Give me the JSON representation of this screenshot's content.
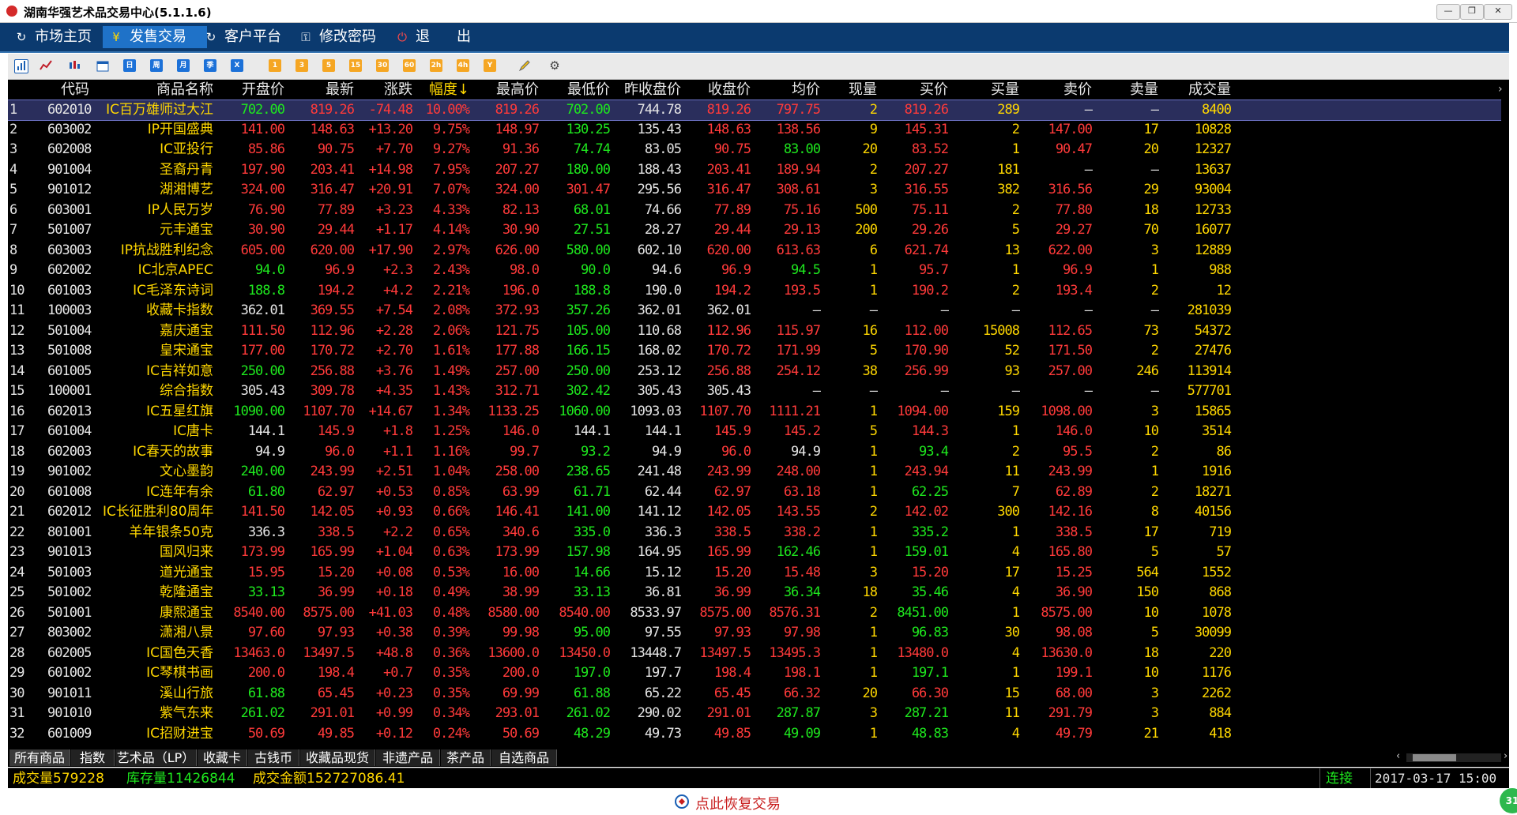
{
  "window": {
    "title": "湖南华强艺术品交易中心(5.1.1.6)"
  },
  "menu": [
    {
      "label": "市场主页",
      "icon": "refresh-icon",
      "glyph": "↻"
    },
    {
      "label": "发售交易",
      "icon": "yen-icon",
      "glyph": "¥",
      "active": true
    },
    {
      "label": "客户平台",
      "icon": "refresh-icon",
      "glyph": "↻"
    },
    {
      "label": "修改密码",
      "icon": "key-icon",
      "glyph": "⚿"
    },
    {
      "label": "退",
      "icon": "power-icon",
      "glyph": "⏻"
    },
    {
      "label": "出",
      "icon": "",
      "glyph": ""
    }
  ],
  "toolbar": {
    "items": [
      {
        "name": "list-view-icon",
        "text": "",
        "color": "#1a5fb4"
      },
      {
        "name": "line-chart-icon",
        "text": "",
        "color": "#c01c28"
      },
      {
        "name": "candlestick-icon",
        "text": "",
        "color": "#1a5fb4"
      },
      {
        "name": "calendar-icon",
        "text": "",
        "color": "#1a5fb4"
      },
      {
        "name": "day-icon",
        "text": "日",
        "color": "#1c71d8"
      },
      {
        "name": "week-icon",
        "text": "周",
        "color": "#1c71d8"
      },
      {
        "name": "month-icon",
        "text": "月",
        "color": "#1c71d8"
      },
      {
        "name": "quarter-icon",
        "text": "季",
        "color": "#1c71d8"
      },
      {
        "name": "x-period-icon",
        "text": "X",
        "color": "#1c71d8"
      },
      {
        "name": "1min-icon",
        "text": "1",
        "color": "#f5a623"
      },
      {
        "name": "3min-icon",
        "text": "3",
        "color": "#f5a623"
      },
      {
        "name": "5min-icon",
        "text": "5",
        "color": "#f5a623"
      },
      {
        "name": "15min-icon",
        "text": "15",
        "color": "#f5a623"
      },
      {
        "name": "30min-icon",
        "text": "30",
        "color": "#f5a623"
      },
      {
        "name": "60min-icon",
        "text": "60",
        "color": "#f5a623"
      },
      {
        "name": "2h-icon",
        "text": "2h",
        "color": "#f5a623"
      },
      {
        "name": "4h-icon",
        "text": "4h",
        "color": "#f5a623"
      },
      {
        "name": "year-icon",
        "text": "Y",
        "color": "#f5a623"
      },
      {
        "name": "draw-pencil-icon",
        "text": "",
        "color": "#666666"
      },
      {
        "name": "settings-gear-icon",
        "text": "⚙",
        "color": "#444444"
      }
    ]
  },
  "table": {
    "columns": [
      "",
      "代码",
      "商品名称",
      "开盘价",
      "最新",
      "涨跌",
      "幅度↓",
      "最高价",
      "最低价",
      "昨收盘价",
      "收盘价",
      "均价",
      "现量",
      "买价",
      "买量",
      "卖价",
      "卖量",
      "成交量"
    ],
    "rows": [
      [
        "1",
        "602010",
        "IC百万雄师过大江",
        "702.00",
        "819.26",
        "-74.48",
        "10.00%",
        "819.26",
        "702.00",
        "744.78",
        "819.26",
        "797.75",
        "2",
        "819.26",
        "289",
        "—",
        "—",
        "8400"
      ],
      [
        "2",
        "603002",
        "IP开国盛典",
        "141.00",
        "148.63",
        "+13.20",
        "9.75%",
        "148.97",
        "130.25",
        "135.43",
        "148.63",
        "138.56",
        "9",
        "145.31",
        "2",
        "147.00",
        "17",
        "10828"
      ],
      [
        "3",
        "602008",
        "IC亚投行",
        "85.86",
        "90.75",
        "+7.70",
        "9.27%",
        "91.36",
        "74.74",
        "83.05",
        "90.75",
        "83.00",
        "20",
        "83.52",
        "1",
        "90.47",
        "20",
        "12327"
      ],
      [
        "4",
        "901004",
        "圣裔丹青",
        "197.90",
        "203.41",
        "+14.98",
        "7.95%",
        "207.27",
        "180.00",
        "188.43",
        "203.41",
        "189.94",
        "2",
        "207.27",
        "181",
        "—",
        "—",
        "13637"
      ],
      [
        "5",
        "901012",
        "湖湘博艺",
        "324.00",
        "316.47",
        "+20.91",
        "7.07%",
        "324.00",
        "301.47",
        "295.56",
        "316.47",
        "308.61",
        "3",
        "316.55",
        "382",
        "316.56",
        "29",
        "93004"
      ],
      [
        "6",
        "603001",
        "IP人民万岁",
        "76.90",
        "77.89",
        "+3.23",
        "4.33%",
        "82.13",
        "68.01",
        "74.66",
        "77.89",
        "75.16",
        "500",
        "75.11",
        "2",
        "77.80",
        "18",
        "12733"
      ],
      [
        "7",
        "501007",
        "元丰通宝",
        "30.90",
        "29.44",
        "+1.17",
        "4.14%",
        "30.90",
        "27.51",
        "28.27",
        "29.44",
        "29.13",
        "200",
        "29.26",
        "5",
        "29.27",
        "70",
        "16077"
      ],
      [
        "8",
        "603003",
        "IP抗战胜利纪念",
        "605.00",
        "620.00",
        "+17.90",
        "2.97%",
        "626.00",
        "580.00",
        "602.10",
        "620.00",
        "613.63",
        "6",
        "621.74",
        "13",
        "622.00",
        "3",
        "12889"
      ],
      [
        "9",
        "602002",
        "IC北京APEC",
        "94.0",
        "96.9",
        "+2.3",
        "2.43%",
        "98.0",
        "90.0",
        "94.6",
        "96.9",
        "94.5",
        "1",
        "95.7",
        "1",
        "96.9",
        "1",
        "988"
      ],
      [
        "10",
        "601003",
        "IC毛泽东诗词",
        "188.8",
        "194.2",
        "+4.2",
        "2.21%",
        "196.0",
        "188.8",
        "190.0",
        "194.2",
        "193.5",
        "1",
        "190.2",
        "2",
        "193.4",
        "2",
        "12"
      ],
      [
        "11",
        "100003",
        "收藏卡指数",
        "362.01",
        "369.55",
        "+7.54",
        "2.08%",
        "372.93",
        "357.26",
        "362.01",
        "362.01",
        "—",
        "—",
        "—",
        "—",
        "—",
        "—",
        "281039"
      ],
      [
        "12",
        "501004",
        "嘉庆通宝",
        "111.50",
        "112.96",
        "+2.28",
        "2.06%",
        "121.75",
        "105.00",
        "110.68",
        "112.96",
        "115.97",
        "16",
        "112.00",
        "15008",
        "112.65",
        "73",
        "54372"
      ],
      [
        "13",
        "501008",
        "皇宋通宝",
        "177.00",
        "170.72",
        "+2.70",
        "1.61%",
        "177.88",
        "166.15",
        "168.02",
        "170.72",
        "171.99",
        "5",
        "170.90",
        "52",
        "171.50",
        "2",
        "27476"
      ],
      [
        "14",
        "601005",
        "IC吉祥如意",
        "250.00",
        "256.88",
        "+3.76",
        "1.49%",
        "257.00",
        "250.00",
        "253.12",
        "256.88",
        "254.12",
        "38",
        "256.99",
        "93",
        "257.00",
        "246",
        "113914"
      ],
      [
        "15",
        "100001",
        "综合指数",
        "305.43",
        "309.78",
        "+4.35",
        "1.43%",
        "312.71",
        "302.42",
        "305.43",
        "305.43",
        "—",
        "—",
        "—",
        "—",
        "—",
        "—",
        "577701"
      ],
      [
        "16",
        "602013",
        "IC五星红旗",
        "1090.00",
        "1107.70",
        "+14.67",
        "1.34%",
        "1133.25",
        "1060.00",
        "1093.03",
        "1107.70",
        "1111.21",
        "1",
        "1094.00",
        "159",
        "1098.00",
        "3",
        "15865"
      ],
      [
        "17",
        "601004",
        "IC唐卡",
        "144.1",
        "145.9",
        "+1.8",
        "1.25%",
        "146.0",
        "144.1",
        "144.1",
        "145.9",
        "145.2",
        "5",
        "144.3",
        "1",
        "146.0",
        "10",
        "3514"
      ],
      [
        "18",
        "602003",
        "IC春天的故事",
        "94.9",
        "96.0",
        "+1.1",
        "1.16%",
        "99.7",
        "93.2",
        "94.9",
        "96.0",
        "94.9",
        "1",
        "93.4",
        "2",
        "95.5",
        "2",
        "86"
      ],
      [
        "19",
        "901002",
        "文心墨韵",
        "240.00",
        "243.99",
        "+2.51",
        "1.04%",
        "258.00",
        "238.65",
        "241.48",
        "243.99",
        "248.00",
        "1",
        "243.94",
        "11",
        "243.99",
        "1",
        "1916"
      ],
      [
        "20",
        "601008",
        "IC连年有余",
        "61.80",
        "62.97",
        "+0.53",
        "0.85%",
        "63.99",
        "61.71",
        "62.44",
        "62.97",
        "63.18",
        "1",
        "62.25",
        "7",
        "62.89",
        "2",
        "18271"
      ],
      [
        "21",
        "602012",
        "IC长征胜利80周年",
        "141.50",
        "142.05",
        "+0.93",
        "0.66%",
        "146.41",
        "141.00",
        "141.12",
        "142.05",
        "143.55",
        "2",
        "142.02",
        "300",
        "142.16",
        "8",
        "40156"
      ],
      [
        "22",
        "801001",
        "羊年银条50克",
        "336.3",
        "338.5",
        "+2.2",
        "0.65%",
        "340.6",
        "335.0",
        "336.3",
        "338.5",
        "338.2",
        "1",
        "335.2",
        "1",
        "338.5",
        "17",
        "719"
      ],
      [
        "23",
        "901013",
        "国风归来",
        "173.99",
        "165.99",
        "+1.04",
        "0.63%",
        "173.99",
        "157.98",
        "164.95",
        "165.99",
        "162.46",
        "1",
        "159.01",
        "4",
        "165.80",
        "5",
        "57"
      ],
      [
        "24",
        "501003",
        "道光通宝",
        "15.95",
        "15.20",
        "+0.08",
        "0.53%",
        "16.00",
        "14.66",
        "15.12",
        "15.20",
        "15.48",
        "3",
        "15.20",
        "17",
        "15.25",
        "564",
        "1552"
      ],
      [
        "25",
        "501002",
        "乾隆通宝",
        "33.13",
        "36.99",
        "+0.18",
        "0.49%",
        "38.99",
        "33.13",
        "36.81",
        "36.99",
        "36.34",
        "18",
        "35.46",
        "4",
        "36.90",
        "150",
        "868"
      ],
      [
        "26",
        "501001",
        "康熙通宝",
        "8540.00",
        "8575.00",
        "+41.03",
        "0.48%",
        "8580.00",
        "8540.00",
        "8533.97",
        "8575.00",
        "8576.31",
        "2",
        "8451.00",
        "1",
        "8575.00",
        "10",
        "1078"
      ],
      [
        "27",
        "803002",
        "潇湘八景",
        "97.60",
        "97.93",
        "+0.38",
        "0.39%",
        "99.98",
        "95.00",
        "97.55",
        "97.93",
        "97.98",
        "1",
        "96.83",
        "30",
        "98.08",
        "5",
        "30099"
      ],
      [
        "28",
        "602005",
        "IC国色天香",
        "13463.0",
        "13497.5",
        "+48.8",
        "0.36%",
        "13600.0",
        "13450.0",
        "13448.7",
        "13497.5",
        "13495.3",
        "1",
        "13480.0",
        "4",
        "13630.0",
        "18",
        "220"
      ],
      [
        "29",
        "601002",
        "IC琴棋书画",
        "200.0",
        "198.4",
        "+0.7",
        "0.35%",
        "200.0",
        "197.0",
        "197.7",
        "198.4",
        "198.1",
        "1",
        "197.1",
        "1",
        "199.1",
        "10",
        "1176"
      ],
      [
        "30",
        "901011",
        "溪山行旅",
        "61.88",
        "65.45",
        "+0.23",
        "0.35%",
        "69.99",
        "61.88",
        "65.22",
        "65.45",
        "66.32",
        "20",
        "66.30",
        "15",
        "68.00",
        "3",
        "2262"
      ],
      [
        "31",
        "901010",
        "紫气东来",
        "261.02",
        "291.01",
        "+0.99",
        "0.34%",
        "293.01",
        "261.02",
        "290.02",
        "291.01",
        "287.87",
        "3",
        "287.21",
        "11",
        "291.79",
        "3",
        "884"
      ],
      [
        "32",
        "601009",
        "IC招财进宝",
        "50.69",
        "49.85",
        "+0.12",
        "0.24%",
        "50.69",
        "48.29",
        "49.73",
        "49.85",
        "49.09",
        "1",
        "48.83",
        "4",
        "49.79",
        "21",
        "418"
      ]
    ]
  },
  "tabs": [
    {
      "label": "所有商品",
      "active": true
    },
    {
      "label": "指数"
    },
    {
      "label": "艺术品（LP）"
    },
    {
      "label": "收藏卡"
    },
    {
      "label": "古钱币"
    },
    {
      "label": "收藏品现货"
    },
    {
      "label": "非遗产品"
    },
    {
      "label": "茶产品"
    },
    {
      "label": "自选商品"
    }
  ],
  "status": {
    "volume": "成交量579228",
    "inventory": "库存量11426844",
    "amount": "成交金额152727086.41",
    "connection": "连接",
    "datetime": "2017-03-17 15:00"
  },
  "footer": {
    "restore_label": "点此恢复交易",
    "badge": "31"
  },
  "colors": {
    "up": "#ff3a3a",
    "down": "#1ee81e",
    "flat": "#e6e6e6",
    "name": "#ffd700",
    "menu_bg": "#0b3a6f",
    "menu_active": "#1f72c8"
  }
}
